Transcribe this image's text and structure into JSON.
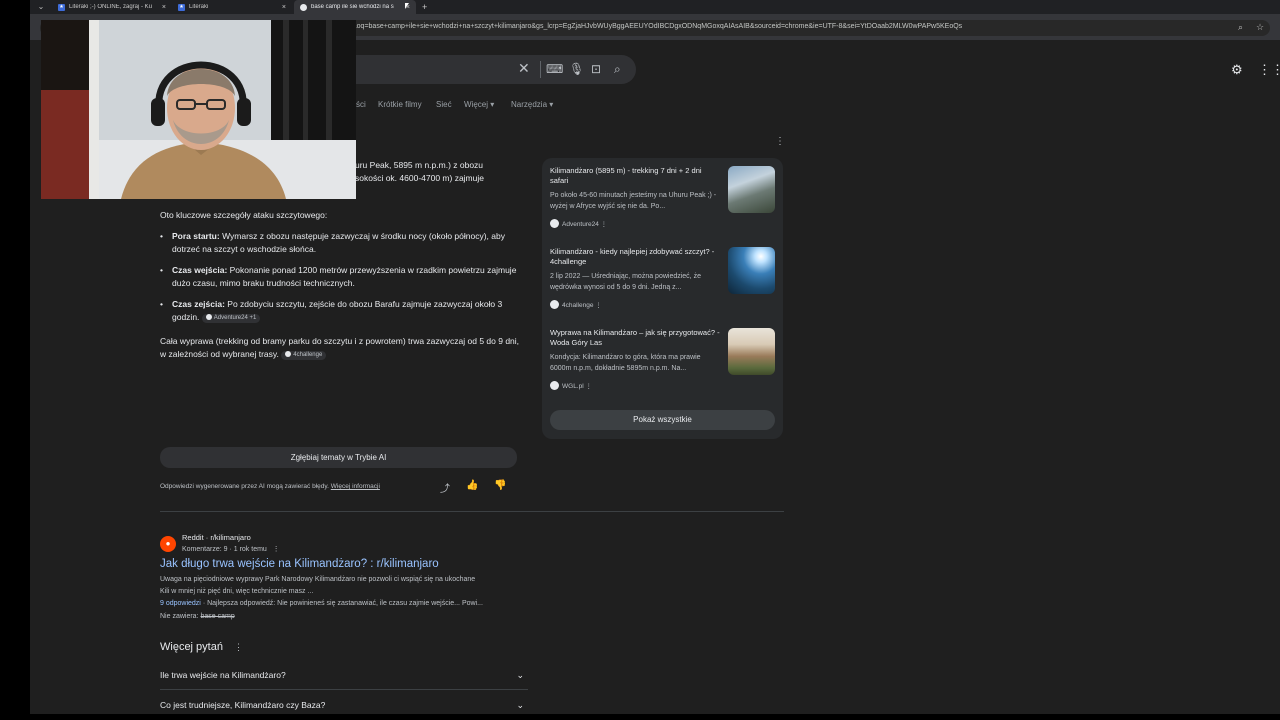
{
  "tabs": [
    {
      "title": "Literaki ;-) ONLINE, zagraj - Ku",
      "close": "×"
    },
    {
      "title": "Literaki",
      "close": "×"
    },
    {
      "title": "base camp ile sie wchodzi na s",
      "close": "×",
      "active": true
    }
  ],
  "new_tab": "+",
  "url": "&oq=base+camp+ile+sie+wchodzi+na+szczyt+kilimanjaro&gs_lcrp=EgZjaHJvbWUyBggAEEUYOdIBCDgxODNqMGoxqAIAsAIB&sourceid=chrome&ie=UTF-8&sei=YtDOaab2MLW0wPAPw5KEoQs",
  "nav_tabs": [
    "ści",
    "Krótkie filmy",
    "Sieć",
    "Więcej ▾",
    "Narzędzia ▾"
  ],
  "ai_overview": {
    "intro_line1": "uru Peak, 5895 m n.p.m.) z obozu",
    "intro_line2": "sokości ok. 4600-4700 m) zajmuje",
    "details_heading": "Oto kluczowe szczegóły ataku szczytowego:",
    "bullets": [
      {
        "label": "Pora startu:",
        "text": " Wymarsz z obozu następuje zazwyczaj w środku nocy (około północy), aby dotrzeć na szczyt o wschodzie słońca."
      },
      {
        "label": "Czas wejścia:",
        "text": " Pokonanie ponad 1200 metrów przewyższenia w rzadkim powietrzu zajmuje dużo czasu, mimo braku trudności technicznych."
      },
      {
        "label": "Czas zejścia:",
        "text": " Po zdobyciu szczytu, zejście do obozu Barafu zajmuje zazwyczaj około 3 godzin.",
        "chip": "Adventure24 +1"
      }
    ],
    "summary": "Cała wyprawa (trekking od bramy parku do szczytu i z powrotem) trwa zazwyczaj od 5 do 9 dni, w zależności od wybranej trasy.",
    "summary_chip": "4challenge",
    "deep_dive_button": "Zgłębiaj tematy w Trybie AI",
    "disclaimer": "Odpowiedzi wygenerowane przez AI mogą zawierać błędy. ",
    "disclaimer_link": "Więcej informacji"
  },
  "sources": [
    {
      "title": "Kilimandżaro (5895 m) - trekking 7 dni + 2 dni safari",
      "snippet": "Po około 45-60 minutach jesteśmy na Uhuru Peak ;) - wyżej w Afryce wyjść się nie da. Po...",
      "site": "Adventure24"
    },
    {
      "title": "Kilimandżaro - kiedy najlepiej zdobywać szczyt? - 4challenge",
      "snippet": "2 lip 2022 — Uśredniając, można powiedzieć, że wędrówka wynosi od 5 do 9 dni. Jedną z...",
      "site": "4challenge"
    },
    {
      "title": "Wyprawa na Kilimandżaro – jak się przygotować? - Woda Góry Las",
      "snippet": "Kondycja: Kilimandżaro to góra, która ma prawie 6000m n.p.m, dokładnie 5895m n.p.m. Na...",
      "site": "WGL.pl"
    }
  ],
  "show_all": "Pokaż wszystkie",
  "result": {
    "source": "Reddit · r/kilimanjaro",
    "meta": "Komentarze: 9 · 1 rok temu",
    "title": "Jak długo trwa wejście na Kilimandżaro? : r/kilimanjaro",
    "snippet_line1": "Uwaga na pięciodniowe wyprawy Park Narodowy Kilimandżaro nie pozwoli ci wspiąć się na ukochane",
    "snippet_line2": "Kili w mniej niż pięć dni, więc technicznie masz ...",
    "answers_link": "9 odpowiedzi",
    "answers_text": " · Najlepsza odpowiedź: Nie powinieneś się zastanawiać, ile czasu zajmie wejście... Powi...",
    "missing_label": "Nie zawiera: ",
    "missing_terms": "base camp"
  },
  "more_questions": {
    "heading": "Więcej pytań",
    "questions": [
      "Ile trwa wejście na Kilimandżaro?",
      "Co jest trudniejsze, Kilimandżaro czy Baza?"
    ]
  },
  "colors": {
    "page_bg": "#1f1f1f",
    "link": "#99c3ff",
    "panel": "#282a2c"
  }
}
